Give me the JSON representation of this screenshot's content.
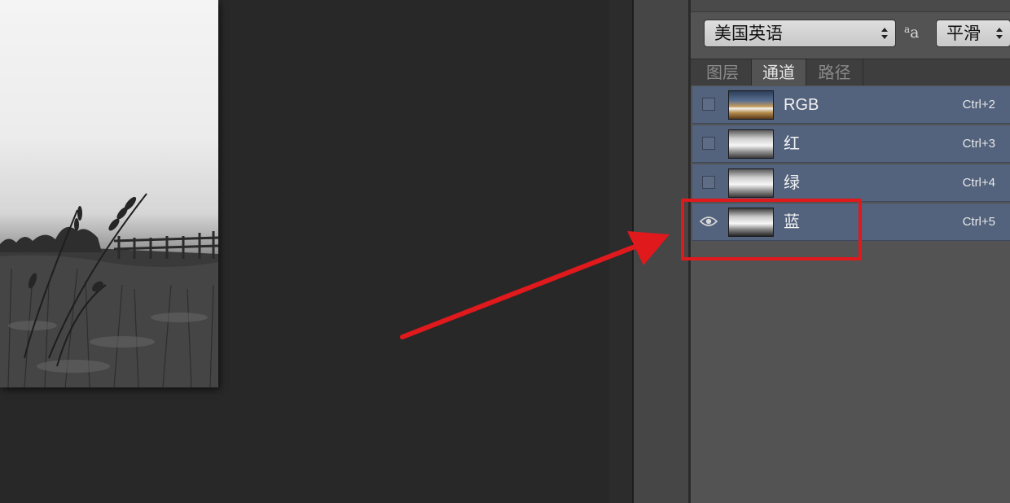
{
  "character_panel": {
    "language_select": "美国英语",
    "aa_icon_large": "a",
    "aa_icon_small": "a",
    "antialias_select": "平滑"
  },
  "panel_tabs": [
    {
      "label": "图层",
      "active": false
    },
    {
      "label": "通道",
      "active": true
    },
    {
      "label": "路径",
      "active": false
    }
  ],
  "channels": [
    {
      "name": "RGB",
      "shortcut": "Ctrl+2",
      "visible": false,
      "thumbnail": "color"
    },
    {
      "name": "红",
      "shortcut": "Ctrl+3",
      "visible": false,
      "thumbnail": "gray"
    },
    {
      "name": "绿",
      "shortcut": "Ctrl+4",
      "visible": false,
      "thumbnail": "gray"
    },
    {
      "name": "蓝",
      "shortcut": "Ctrl+5",
      "visible": true,
      "thumbnail": "gray"
    }
  ],
  "annotation": {
    "highlighted_channel": "蓝",
    "color": "#e0191c"
  },
  "colors": {
    "workspace": "#282828",
    "panel": "#535353",
    "selected_row": "#53627d"
  }
}
